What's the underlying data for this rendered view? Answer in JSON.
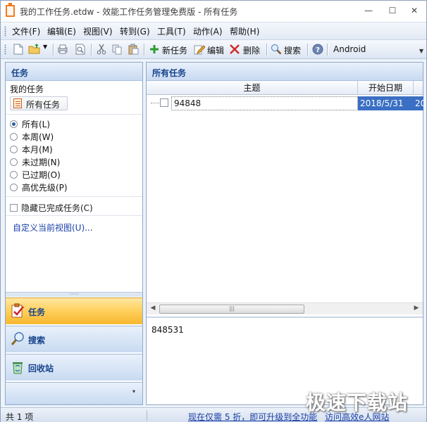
{
  "window": {
    "title": "我的工作任务.etdw - 效能工作任务管理免费版 - 所有任务",
    "min_glyph": "—",
    "max_glyph": "☐",
    "close_glyph": "✕",
    "accent_color": "#f07b1c"
  },
  "menu": {
    "items": [
      "文件(F)",
      "编辑(E)",
      "视图(V)",
      "转到(G)",
      "工具(T)",
      "动作(A)",
      "帮助(H)"
    ]
  },
  "toolbar": {
    "new_task_label": "新任务",
    "edit_label": "编辑",
    "delete_label": "删除",
    "search_label": "搜索",
    "android_label": "Android",
    "icons": [
      "new-document-icon",
      "open-folder-icon",
      "print-icon",
      "print-preview-icon",
      "cut-icon",
      "copy-icon",
      "paste-icon",
      "plus-icon",
      "pencil-icon",
      "delete-x-icon",
      "magnifier-icon",
      "help-icon"
    ]
  },
  "left_panel": {
    "header": "任务",
    "section_label": "我的任务",
    "all_tasks_button": "所有任务",
    "filters": [
      {
        "label": "所有(L)",
        "selected": true
      },
      {
        "label": "本周(W)",
        "selected": false
      },
      {
        "label": "本月(M)",
        "selected": false
      },
      {
        "label": "未过期(N)",
        "selected": false
      },
      {
        "label": "已过期(O)",
        "selected": false
      },
      {
        "label": "高优先级(P)",
        "selected": false
      }
    ],
    "hide_completed_label": "隐藏已完成任务(C)",
    "customize_view_link": "自定义当前视图(U)...",
    "splitter_glyph": "·····",
    "nav": {
      "tasks": "任务",
      "search": "搜索",
      "recycle_bin": "回收站"
    },
    "footer_glyph": "▾"
  },
  "right_panel": {
    "header": "所有任务",
    "columns": [
      "主题",
      "开始日期"
    ],
    "rows": [
      {
        "subject": "94848",
        "start_date": "2018/5/31",
        "more": "20"
      }
    ],
    "preview_text": "848531",
    "scroll_left": "◀",
    "scroll_right": "▶",
    "thumb_grip": "|||"
  },
  "status": {
    "count": "共 1 项",
    "upgrade_text": "现在仅需 5 折，即可升级到全功能",
    "link_text": "访问高效e人网站"
  },
  "watermark": "极速下载站"
}
